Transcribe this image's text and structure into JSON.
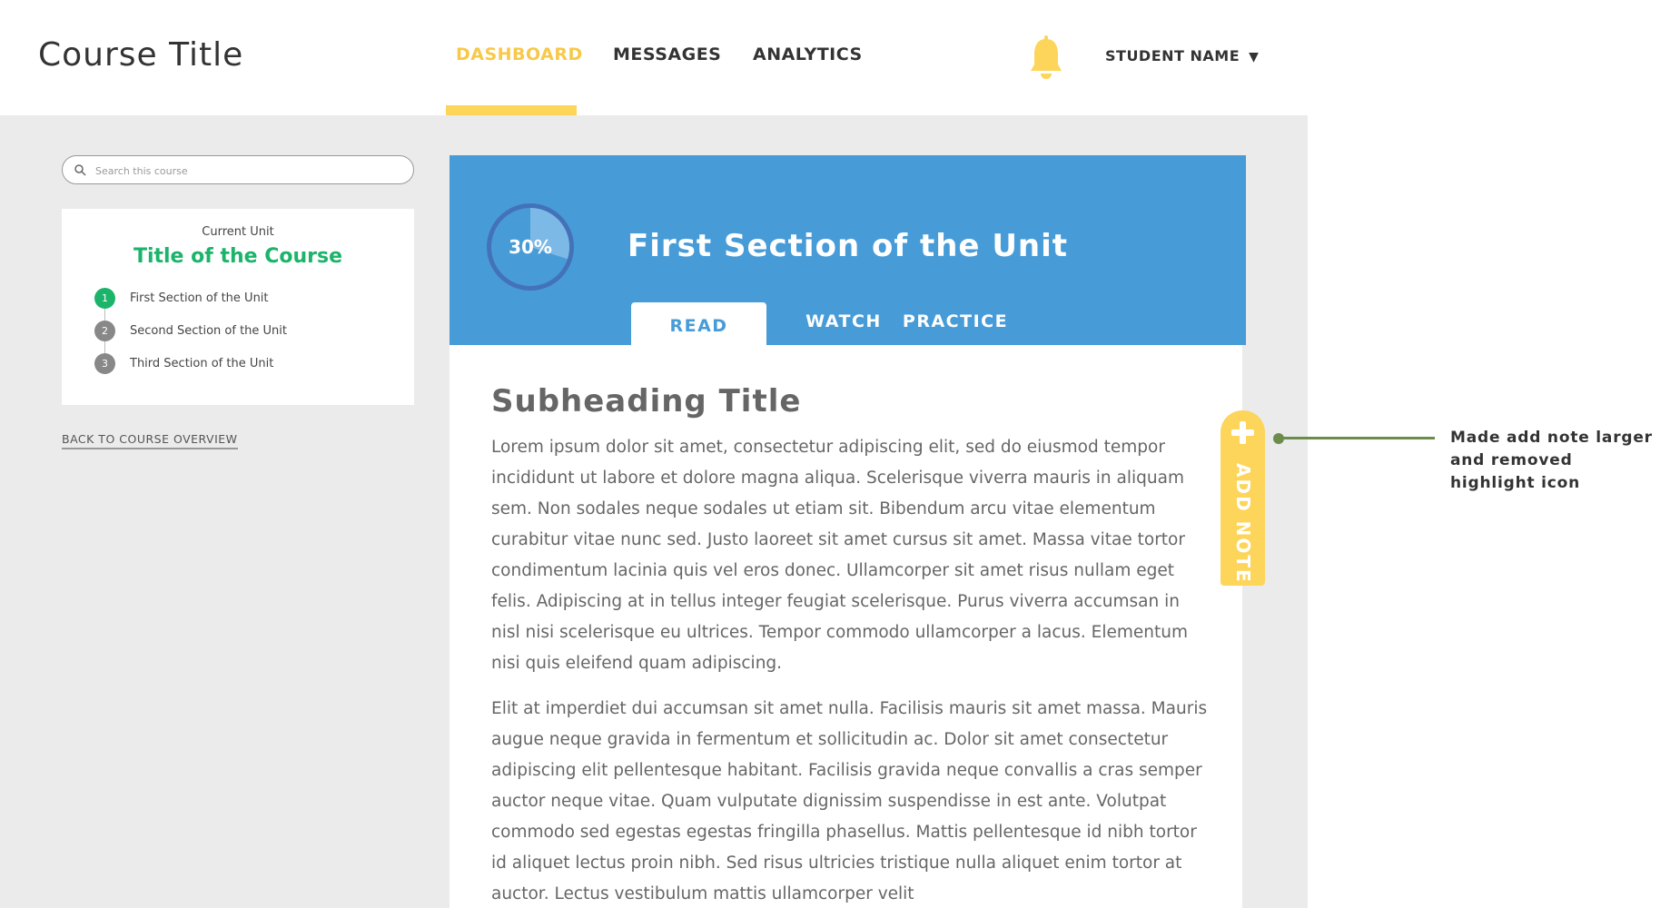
{
  "header": {
    "course_title": "Course Title",
    "nav": [
      {
        "label": "DASHBOARD",
        "active": true
      },
      {
        "label": "MESSAGES",
        "active": false
      },
      {
        "label": "ANALYTICS",
        "active": false
      }
    ],
    "notification_icon": "bell-icon",
    "student_name": "STUDENT NAME",
    "student_caret": "▼"
  },
  "sidebar": {
    "search_placeholder": "Search this course",
    "current_unit_caption": "Current Unit",
    "unit_title": "Title of the Course",
    "steps": [
      {
        "number": "1",
        "label": "First Section of the Unit",
        "status": "current"
      },
      {
        "number": "2",
        "label": "Second Section of the Unit",
        "status": "upcoming"
      },
      {
        "number": "3",
        "label": "Third Section of the Unit",
        "status": "upcoming"
      }
    ],
    "back_link": "BACK TO COURSE OVERVIEW"
  },
  "section": {
    "progress_percent": 30,
    "progress_label": "30%",
    "title": "First Section of the Unit",
    "tabs": [
      {
        "label": "READ",
        "active": true
      },
      {
        "label": "WATCH",
        "active": false
      },
      {
        "label": "PRACTICE",
        "active": false
      }
    ]
  },
  "content": {
    "subheading": "Subheading Title",
    "paragraphs": [
      "Lorem ipsum dolor sit amet, consectetur adipiscing elit, sed do eiusmod tempor incididunt ut labore et dolore magna aliqua. Scelerisque viverra mauris in aliquam sem. Non sodales neque sodales ut etiam sit. Bibendum arcu vitae elementum curabitur vitae nunc sed. Justo laoreet sit amet cursus sit amet. Massa vitae tortor condimentum lacinia quis vel eros donec. Ullamcorper sit amet risus nullam eget felis. Adipiscing at in tellus integer feugiat scelerisque. Purus viverra accumsan in nisl nisi scelerisque eu ultrices. Tempor commodo ullamcorper a lacus. Elementum nisi quis eleifend quam adipiscing.",
      "Elit at imperdiet dui accumsan sit amet nulla. Facilisis mauris sit amet massa. Mauris augue neque gravida in fermentum et sollicitudin ac. Dolor sit amet consectetur adipiscing elit pellentesque habitant. Facilisis gravida neque convallis a cras semper auctor neque vitae. Quam vulputate dignissim suspendisse in est ante. Volutpat commodo sed egestas egestas fringilla phasellus. Mattis pellentesque id nibh tortor id aliquet lectus proin nibh. Sed risus ultricies tristique nulla aliquet enim tortor at auctor. Lectus vestibulum mattis ullamcorper velit"
    ]
  },
  "add_note": {
    "label": "ADD NOTE",
    "icon": "plus-icon"
  },
  "annotation": {
    "text": "Made add note larger and removed highlight icon"
  },
  "colors": {
    "accent_yellow": "#fcd55a",
    "banner_blue": "#479cd8",
    "success_green": "#1bb46a",
    "annotation_green": "#6b8c4a",
    "workspace_gray": "#ebebeb"
  }
}
